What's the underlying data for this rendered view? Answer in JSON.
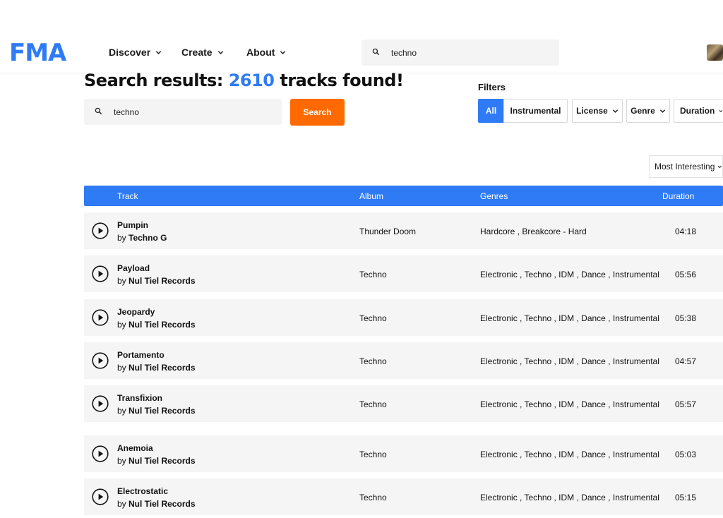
{
  "header": {
    "logo": "FMA",
    "nav": [
      {
        "label": "Discover"
      },
      {
        "label": "Create"
      },
      {
        "label": "About"
      }
    ],
    "search": {
      "value": "techno",
      "icon": "search-icon"
    }
  },
  "results": {
    "prefix": "Search results: ",
    "count": "2610",
    "suffix": " tracks found!"
  },
  "main_search": {
    "value": "techno",
    "button_label": "Search"
  },
  "filters": {
    "label": "Filters",
    "buttons": [
      {
        "label": "All",
        "active": true
      },
      {
        "label": "Instrumental"
      },
      {
        "label": "License"
      },
      {
        "label": "Genre"
      },
      {
        "label": "Duration"
      }
    ]
  },
  "sort": {
    "label": "Most Interesting"
  },
  "table": {
    "columns": {
      "track": "Track",
      "album": "Album",
      "genres": "Genres",
      "duration": "Duration"
    },
    "by_label": "by ",
    "rows": [
      {
        "title": "Pumpin",
        "artist": "Techno G",
        "album": "Thunder Doom",
        "genres": "Hardcore , Breakcore - Hard",
        "duration": "04:18"
      },
      {
        "title": "Payload",
        "artist": "Nul Tiel Records",
        "album": "Techno",
        "genres": "Electronic , Techno , IDM , Dance , Instrumental",
        "duration": "05:56"
      },
      {
        "title": "Jeopardy",
        "artist": "Nul Tiel Records",
        "album": "Techno",
        "genres": "Electronic , Techno , IDM , Dance , Instrumental",
        "duration": "05:38"
      },
      {
        "title": "Portamento",
        "artist": "Nul Tiel Records",
        "album": "Techno",
        "genres": "Electronic , Techno , IDM , Dance , Instrumental",
        "duration": "04:57"
      },
      {
        "title": "Transfixion",
        "artist": "Nul Tiel Records",
        "album": "Techno",
        "genres": "Electronic , Techno , IDM , Dance , Instrumental",
        "duration": "05:57"
      },
      {
        "title": "Anemoia",
        "artist": "Nul Tiel Records",
        "album": "Techno",
        "genres": "Electronic , Techno , IDM , Dance , Instrumental",
        "duration": "05:03"
      },
      {
        "title": "Electrostatic",
        "artist": "Nul Tiel Records",
        "album": "Techno",
        "genres": "Electronic , Techno , IDM , Dance , Instrumental",
        "duration": "05:15"
      }
    ]
  },
  "colors": {
    "brand": "#2f7bf5",
    "search_button": "#ff6a00",
    "row_bg": "#f5f5f5"
  }
}
